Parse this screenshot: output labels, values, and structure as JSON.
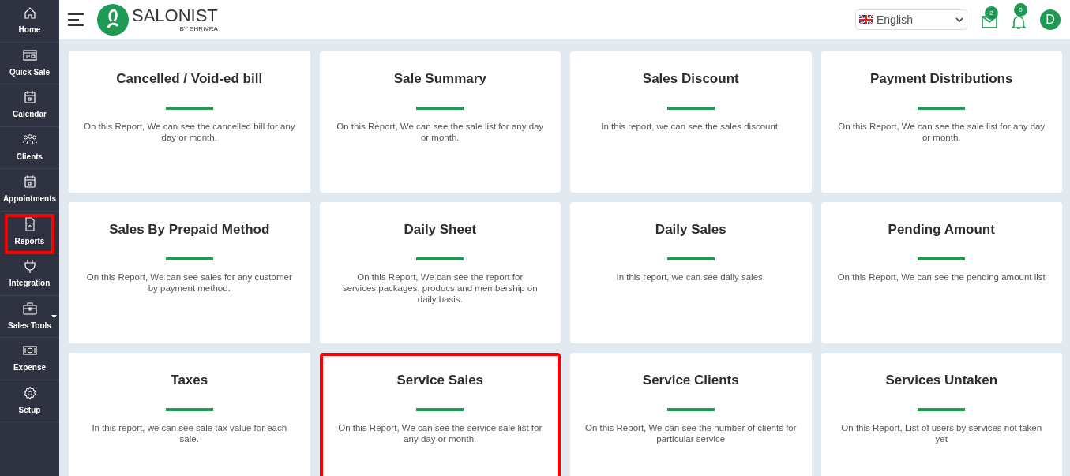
{
  "sidebar": {
    "items": [
      {
        "label": "Home",
        "highlighted": false,
        "dropdown": false
      },
      {
        "label": "Quick Sale",
        "highlighted": false,
        "dropdown": false
      },
      {
        "label": "Calendar",
        "highlighted": false,
        "dropdown": false
      },
      {
        "label": "Clients",
        "highlighted": false,
        "dropdown": false
      },
      {
        "label": "Appointments",
        "highlighted": false,
        "dropdown": false
      },
      {
        "label": "Reports",
        "highlighted": true,
        "dropdown": false
      },
      {
        "label": "Integration",
        "highlighted": false,
        "dropdown": false
      },
      {
        "label": "Sales Tools",
        "highlighted": false,
        "dropdown": true
      },
      {
        "label": "Expense",
        "highlighted": false,
        "dropdown": false
      },
      {
        "label": "Setup",
        "highlighted": false,
        "dropdown": false
      }
    ]
  },
  "header": {
    "logo_name": "SALONIST",
    "logo_tagline": "BY SHRIVRA",
    "language": "English",
    "mail_count": "2",
    "notification_count": "0",
    "avatar": "D"
  },
  "reports": [
    {
      "title": "Cancelled / Void-ed bill",
      "description": "On this Report, We can see the cancelled bill for any day or month.",
      "highlighted": false
    },
    {
      "title": "Sale Summary",
      "description": "On this Report, We can see the sale list for any day or month.",
      "highlighted": false
    },
    {
      "title": "Sales Discount",
      "description": "In this report, we can see the sales discount.",
      "highlighted": false
    },
    {
      "title": "Payment Distributions",
      "description": "On this Report, We can see the sale list for any day or month.",
      "highlighted": false
    },
    {
      "title": "Sales By Prepaid Method",
      "description": "On this Report, We can see sales for any customer by payment method.",
      "highlighted": false
    },
    {
      "title": "Daily Sheet",
      "description": "On this Report, We can see the report for services,packages, producs and membership on daily basis.",
      "highlighted": false
    },
    {
      "title": "Daily Sales",
      "description": "In this report, we can see daily sales.",
      "highlighted": false
    },
    {
      "title": "Pending Amount",
      "description": "On this Report, We can see the pending amount list",
      "highlighted": false
    },
    {
      "title": "Taxes",
      "description": "In this report, we can see sale tax value for each sale.",
      "highlighted": false
    },
    {
      "title": "Service Sales",
      "description": "On this Report, We can see the service sale list for any day or month.",
      "highlighted": true
    },
    {
      "title": "Service Clients",
      "description": "On this Report, We can see the number of clients for particular service",
      "highlighted": false
    },
    {
      "title": "Services Untaken",
      "description": "On this Report, List of users by services not taken yet",
      "highlighted": false
    }
  ]
}
